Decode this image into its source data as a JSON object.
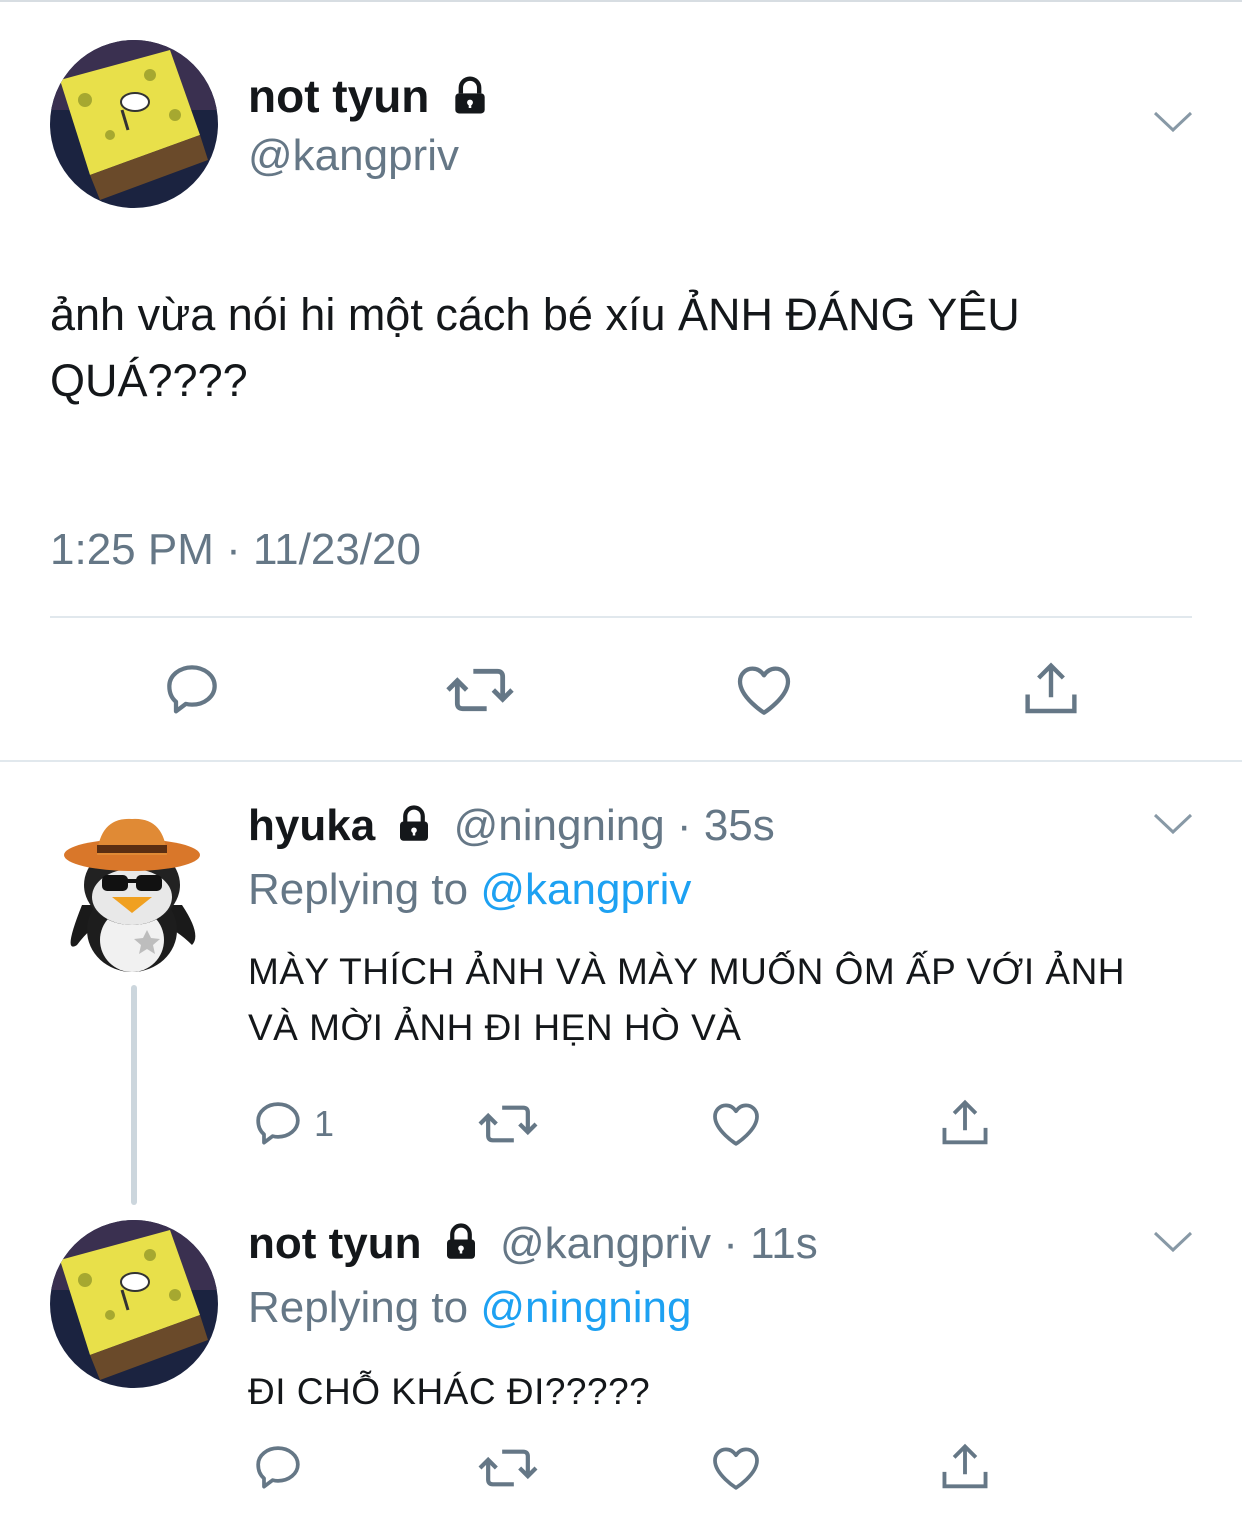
{
  "main_tweet": {
    "display_name": "not tyun",
    "handle": "@kangpriv",
    "text": "ảnh vừa nói hi một cách bé xíu ẢNH ĐÁNG YÊU QUÁ????",
    "timestamp": "1:25 PM · 11/23/20",
    "avatar_icon": "spongebob-avatar-icon"
  },
  "replies": [
    {
      "display_name": "hyuka",
      "handle": "@ningning",
      "time_ago": "35s",
      "replying_label": "Replying to",
      "replying_to": "@kangpriv",
      "text": "MÀY THÍCH ẢNH VÀ MÀY MUỐN ÔM ẤP VỚI ẢNH VÀ MỜI ẢNH ĐI HẸN HÒ VÀ",
      "reply_count": "1",
      "avatar_icon": "penguin-cowboy-avatar-icon"
    },
    {
      "display_name": "not tyun",
      "handle": "@kangpriv",
      "time_ago": "11s",
      "replying_label": "Replying to",
      "replying_to": "@ningning",
      "text": "ĐI CHỖ KHÁC ĐI?????",
      "avatar_icon": "spongebob-avatar-icon"
    }
  ],
  "separator_dot": "·",
  "colors": {
    "text": "#14171a",
    "secondary": "#657786",
    "link": "#1da1f2",
    "divider": "#e1e8ed",
    "thread_line": "#ccd6dd"
  }
}
